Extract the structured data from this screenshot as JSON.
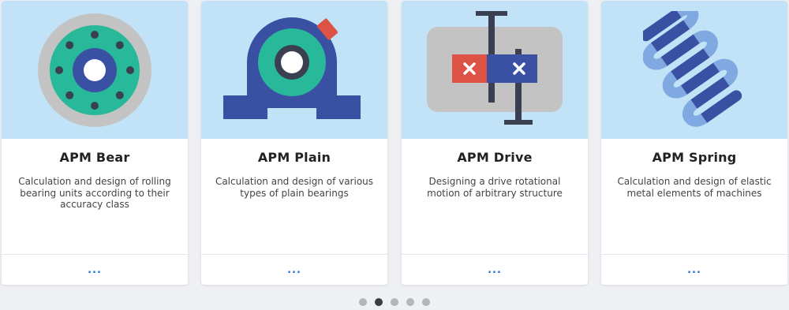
{
  "cards": [
    {
      "title": "APM Bear",
      "description": "Calculation and design of rolling bearing units according to their accuracy class",
      "more_label": "...",
      "icon": "rolling-bearing-icon"
    },
    {
      "title": "APM Plain",
      "description": "Calculation and design of various types of plain bearings",
      "more_label": "...",
      "icon": "plain-bearing-icon"
    },
    {
      "title": "APM Drive",
      "description": "Designing a drive rotational motion of arbitrary structure",
      "more_label": "...",
      "icon": "gear-drive-icon"
    },
    {
      "title": "APM Spring",
      "description": "Calculation and design of elastic metal elements of machines",
      "more_label": "...",
      "icon": "spring-icon"
    }
  ],
  "pager": {
    "count": 5,
    "active_index": 1
  },
  "colors": {
    "card_image_bg": "#c2e3f7",
    "link": "#1a6fd8",
    "teal": "#27b99a",
    "navy": "#3a50a3",
    "gray": "#c3c3c3",
    "red": "#de5246",
    "dark": "#3a3f52"
  }
}
